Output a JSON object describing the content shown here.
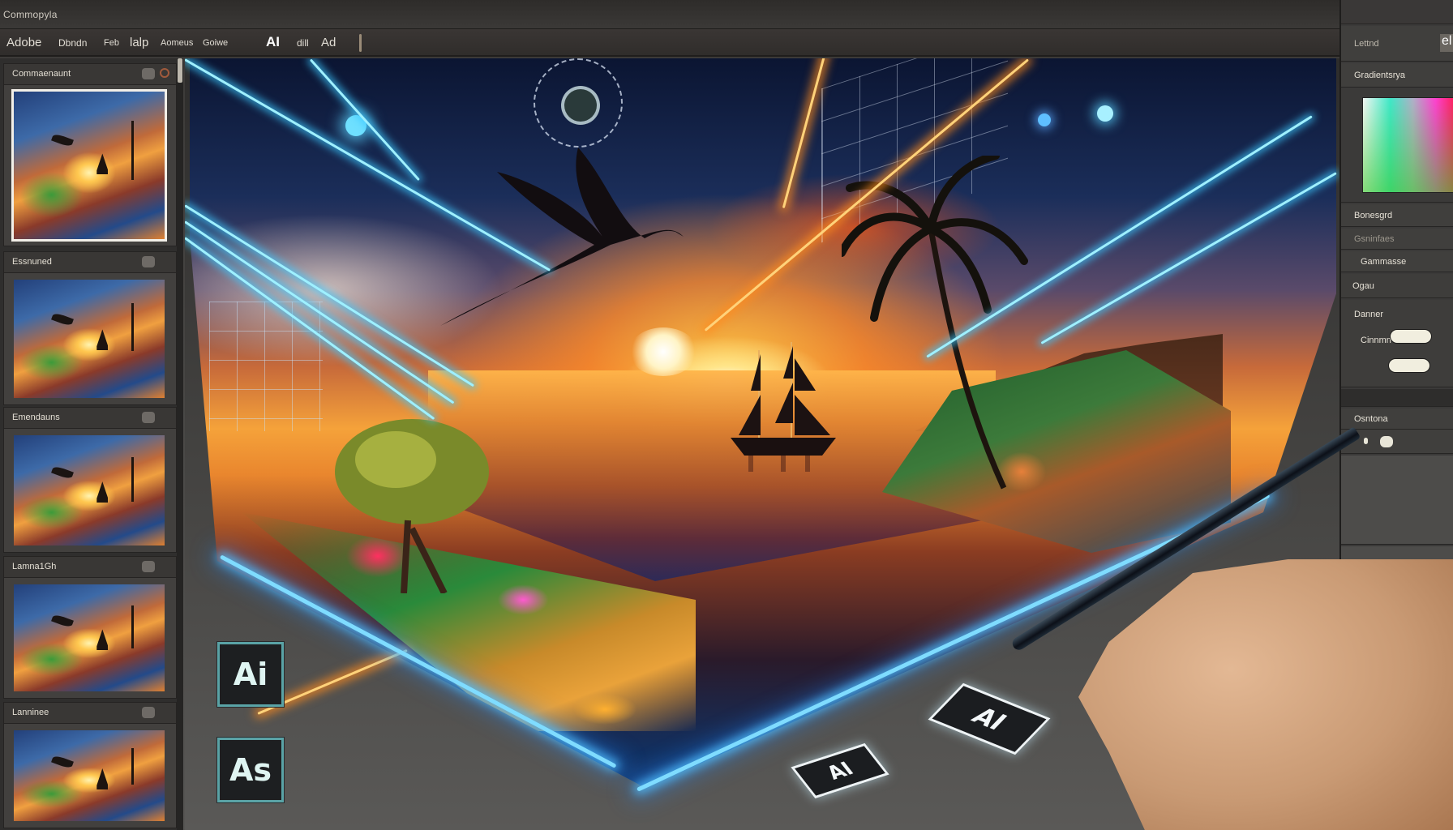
{
  "app": {
    "window_title": "Commopyla",
    "menu": [
      {
        "label": "Adobe",
        "bright": false
      },
      {
        "label": "Dbndn",
        "bright": false
      },
      {
        "label": "Feb",
        "bright": false
      },
      {
        "label": "lalp",
        "bright": false
      },
      {
        "label": "Aomeus",
        "bright": false
      },
      {
        "label": "Goiwe",
        "bright": false
      },
      {
        "label": "AI",
        "bright": true
      },
      {
        "label": "dill",
        "bright": false
      },
      {
        "label": "Ad",
        "bright": false
      }
    ]
  },
  "layers_panel": {
    "cards": [
      {
        "name": "Commaenaunt",
        "selected": true
      },
      {
        "name": "Essnuned",
        "selected": false
      },
      {
        "name": "Emendauns",
        "selected": false
      },
      {
        "name": "Lamna1Gh",
        "selected": false
      },
      {
        "name": "Lanninee",
        "selected": false
      }
    ]
  },
  "app_icons": [
    {
      "label": "Ai",
      "name": "illustrator-app-icon"
    },
    {
      "label": "As",
      "name": "as-app-icon"
    }
  ],
  "stickers": [
    {
      "label": "AI"
    },
    {
      "label": "AI"
    }
  ],
  "properties_panel": {
    "top_label": "Lettnd",
    "top_badge": "el",
    "color_section": "Gradientsrya",
    "rows": [
      {
        "label": "Bonesgrd",
        "dim": false
      },
      {
        "label": "Gsninfaes",
        "dim": true
      },
      {
        "label": "Gammasse",
        "dim": false
      },
      {
        "label": "Ogau",
        "dim": false
      },
      {
        "label": "Danner",
        "dim": false
      },
      {
        "label": "Cinnmn",
        "dim": false
      },
      {
        "label": "Osntona",
        "dim": false
      }
    ],
    "toggle_values": [
      "",
      ""
    ]
  },
  "colors": {
    "panel_bg": "#3b3a39",
    "accent_glow": "#7fdcff",
    "icon_border": "#5aa3a6"
  }
}
